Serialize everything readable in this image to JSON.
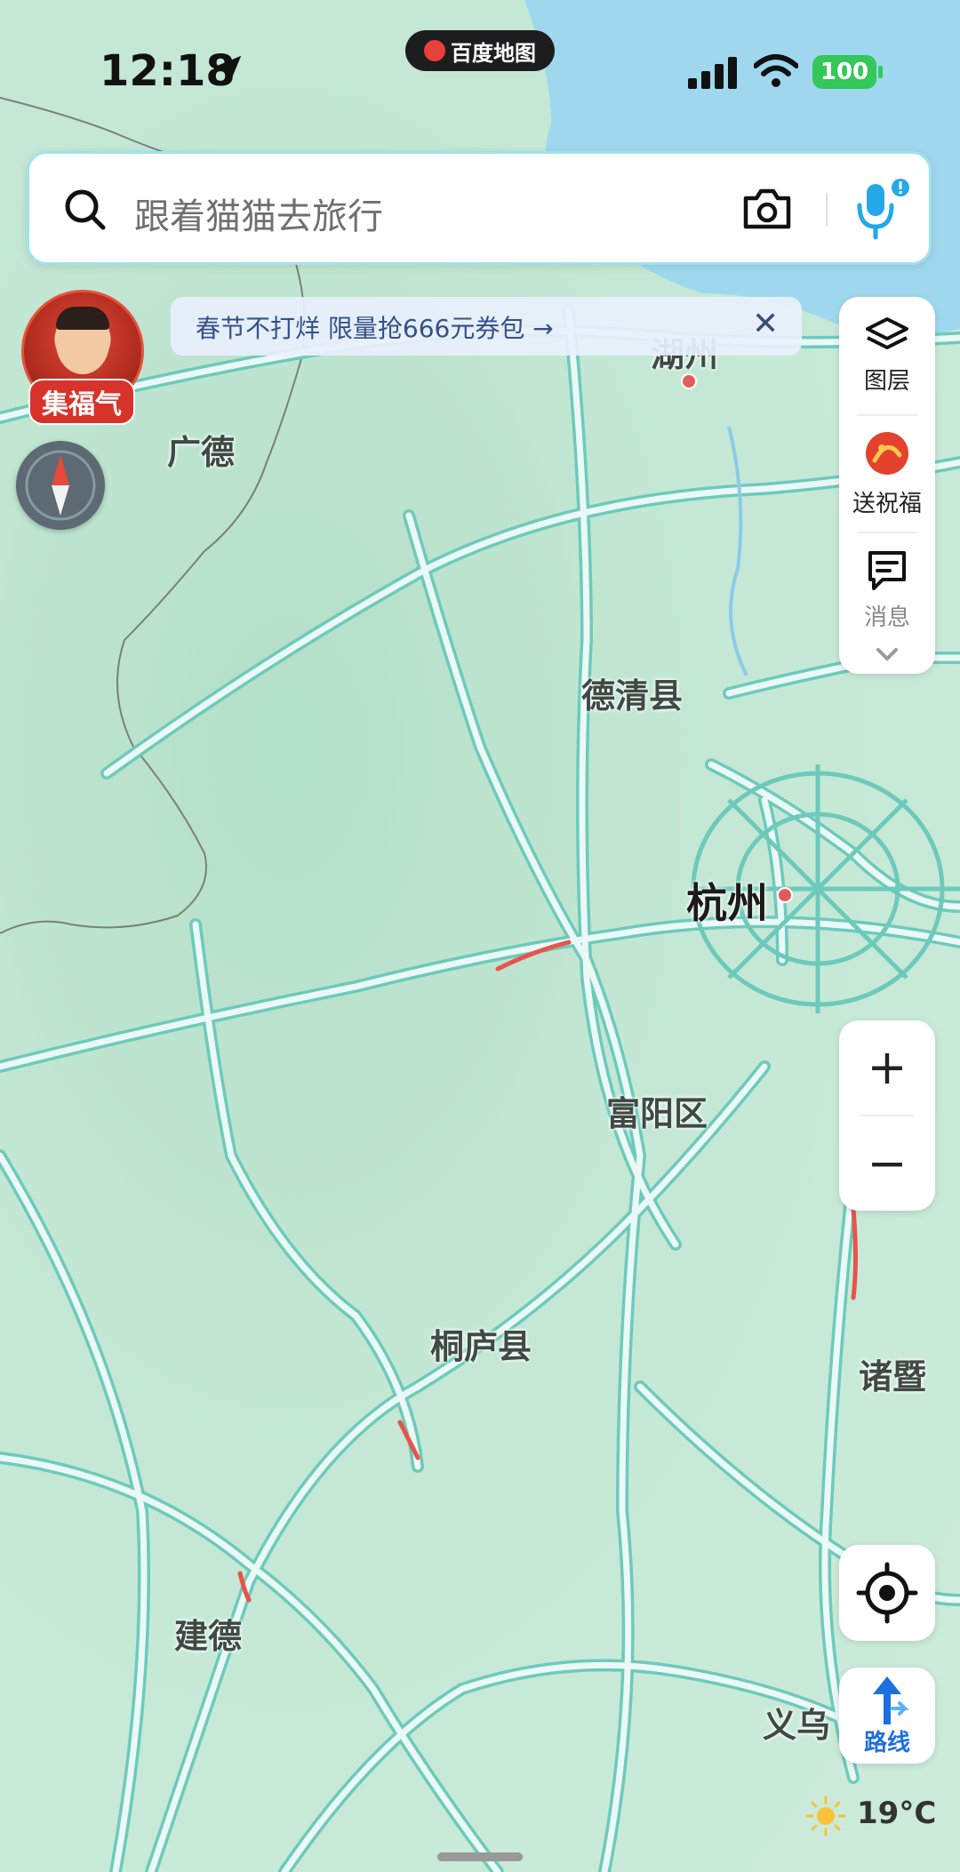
{
  "status_bar": {
    "time": "12:18",
    "app_badge": "百度地图",
    "battery": "100"
  },
  "search": {
    "placeholder": "跟着猫猫去旅行"
  },
  "avatar": {
    "label": "集福气"
  },
  "banner": {
    "text": "春节不打烊 限量抢666元券包 →",
    "close": "✕"
  },
  "side_panel": [
    {
      "label": "图层",
      "icon": "layers-icon"
    },
    {
      "label": "送祝福",
      "icon": "greeting-icon"
    },
    {
      "label": "消息",
      "icon": "message-icon"
    }
  ],
  "zoom": {
    "in": "+",
    "out": "−"
  },
  "route": {
    "label": "路线"
  },
  "weather": {
    "temp": "19°C"
  },
  "map": {
    "places": [
      {
        "name": "湖州"
      },
      {
        "name": "广德"
      },
      {
        "name": "德清县"
      },
      {
        "name": "杭州"
      },
      {
        "name": "富阳区"
      },
      {
        "name": "桐庐县"
      },
      {
        "name": "诸暨"
      },
      {
        "name": "建德"
      },
      {
        "name": "义乌"
      }
    ]
  },
  "colors": {
    "water": "#9fd8ee",
    "road": "#eaf8f6",
    "road_edge": "#5fc8b8",
    "accent": "#1d6fe0"
  }
}
